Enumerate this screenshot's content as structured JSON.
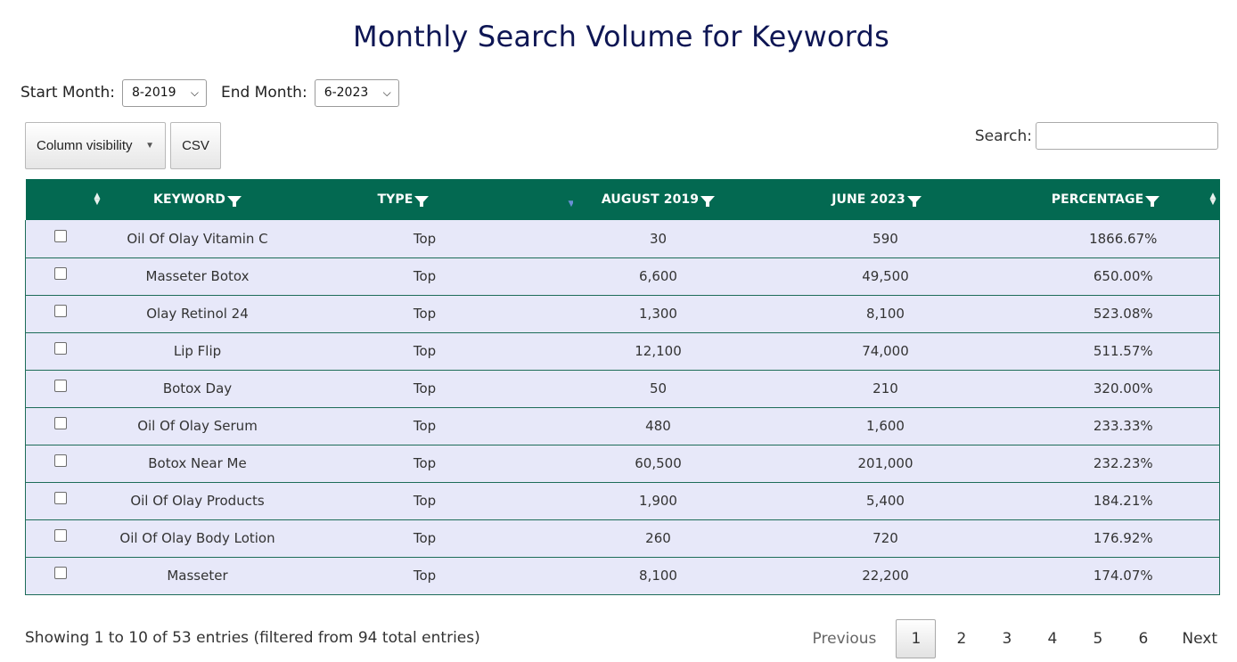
{
  "title": "Monthly Search Volume for Keywords",
  "filters": {
    "start_label": "Start Month:",
    "start_value": "8-2019",
    "end_label": "End Month:",
    "end_value": "6-2023"
  },
  "toolbar": {
    "colvis_label": "Column visibility",
    "csv_label": "CSV"
  },
  "search": {
    "label": "Search:",
    "value": ""
  },
  "table": {
    "headers": [
      "",
      "Keyword",
      "Type",
      "August 2019",
      "June 2023",
      "Percentage"
    ],
    "rows": [
      [
        "Oil Of Olay Vitamin C",
        "Top",
        "30",
        "590",
        "1866.67%"
      ],
      [
        "Masseter Botox",
        "Top",
        "6,600",
        "49,500",
        "650.00%"
      ],
      [
        "Olay Retinol 24",
        "Top",
        "1,300",
        "8,100",
        "523.08%"
      ],
      [
        "Lip Flip",
        "Top",
        "12,100",
        "74,000",
        "511.57%"
      ],
      [
        "Botox Day",
        "Top",
        "50",
        "210",
        "320.00%"
      ],
      [
        "Oil Of Olay Serum",
        "Top",
        "480",
        "1,600",
        "233.33%"
      ],
      [
        "Botox Near Me",
        "Top",
        "60,500",
        "201,000",
        "232.23%"
      ],
      [
        "Oil Of Olay Products",
        "Top",
        "1,900",
        "5,400",
        "184.21%"
      ],
      [
        "Oil Of Olay Body Lotion",
        "Top",
        "260",
        "720",
        "176.92%"
      ],
      [
        "Masseter",
        "Top",
        "8,100",
        "22,200",
        "174.07%"
      ]
    ]
  },
  "footer": {
    "info": "Showing 1 to 10 of 53 entries (filtered from 94 total entries)",
    "previous": "Previous",
    "pages": [
      "1",
      "2",
      "3",
      "4",
      "5",
      "6"
    ],
    "current_page": "1",
    "next": "Next"
  },
  "colors": {
    "header_bg": "#036951",
    "row_bg": "#e7e8f9",
    "title": "#0e1654"
  }
}
